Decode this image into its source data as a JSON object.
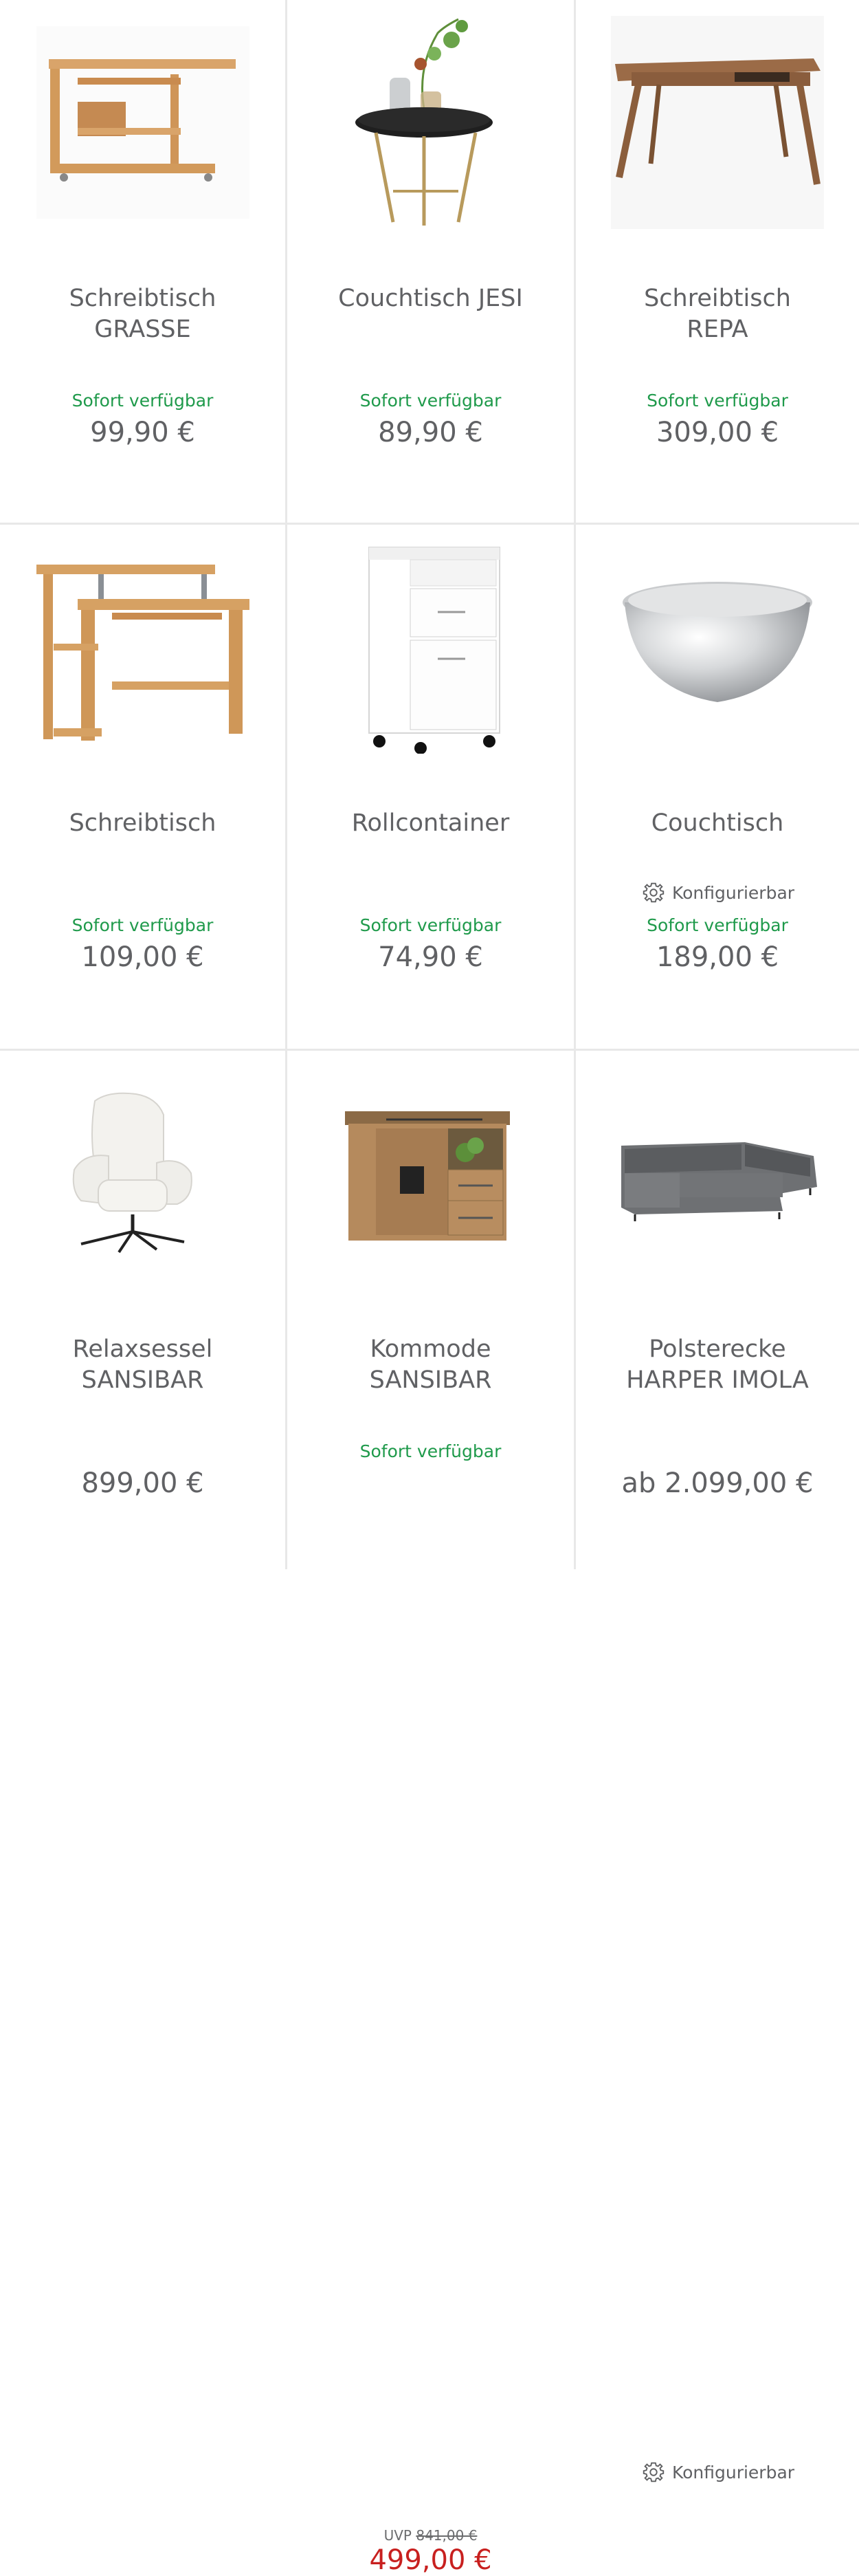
{
  "products": [
    {
      "title_line1": "Schreibtisch",
      "title_line2": "GRASSE",
      "availability": "Sofort verfügbar",
      "price": "99,90 €",
      "image": "desk-grasse-image"
    },
    {
      "title_line1": "Couchtisch JESI",
      "title_line2": "",
      "availability": "Sofort verfügbar",
      "price": "89,90 €",
      "image": "coffee-table-jesi-image"
    },
    {
      "title_line1": "Schreibtisch",
      "title_line2": "REPA",
      "availability": "Sofort verfügbar",
      "price": "309,00 €",
      "image": "desk-repa-image"
    },
    {
      "title_line1": "Schreibtisch",
      "title_line2": "",
      "availability": "Sofort verfügbar",
      "price": "109,00 €",
      "image": "computer-desk-image"
    },
    {
      "title_line1": "Rollcontainer",
      "title_line2": "",
      "availability": "Sofort verfügbar",
      "price": "74,90 €",
      "image": "rolling-container-image"
    },
    {
      "title_line1": "Couchtisch",
      "title_line2": "",
      "config_label": "Konfigurierbar",
      "availability": "Sofort verfügbar",
      "price": "189,00 €",
      "image": "hammered-bowl-table-image"
    },
    {
      "title_line1": "Relaxsessel",
      "title_line2": "SANSIBAR",
      "availability": "",
      "price": "899,00 €",
      "image": "armchair-sansibar-image"
    },
    {
      "title_line1": "Kommode",
      "title_line2": "SANSIBAR",
      "availability": "Sofort verfügbar",
      "uvp_label": "UVP",
      "uvp_price": "841,00 €",
      "price": "499,00 €",
      "image": "sideboard-sansibar-image"
    },
    {
      "title_line1": "Polsterecke",
      "title_line2": "HARPER IMOLA",
      "config_label": "Konfigurierbar",
      "availability": "",
      "price": "ab 2.099,00 €",
      "image": "corner-sofa-image"
    }
  ],
  "colors": {
    "availability_green": "#1f9a4b",
    "sale_red": "#c8201f",
    "text_gray": "#606164",
    "divider": "#e8e8e8"
  }
}
